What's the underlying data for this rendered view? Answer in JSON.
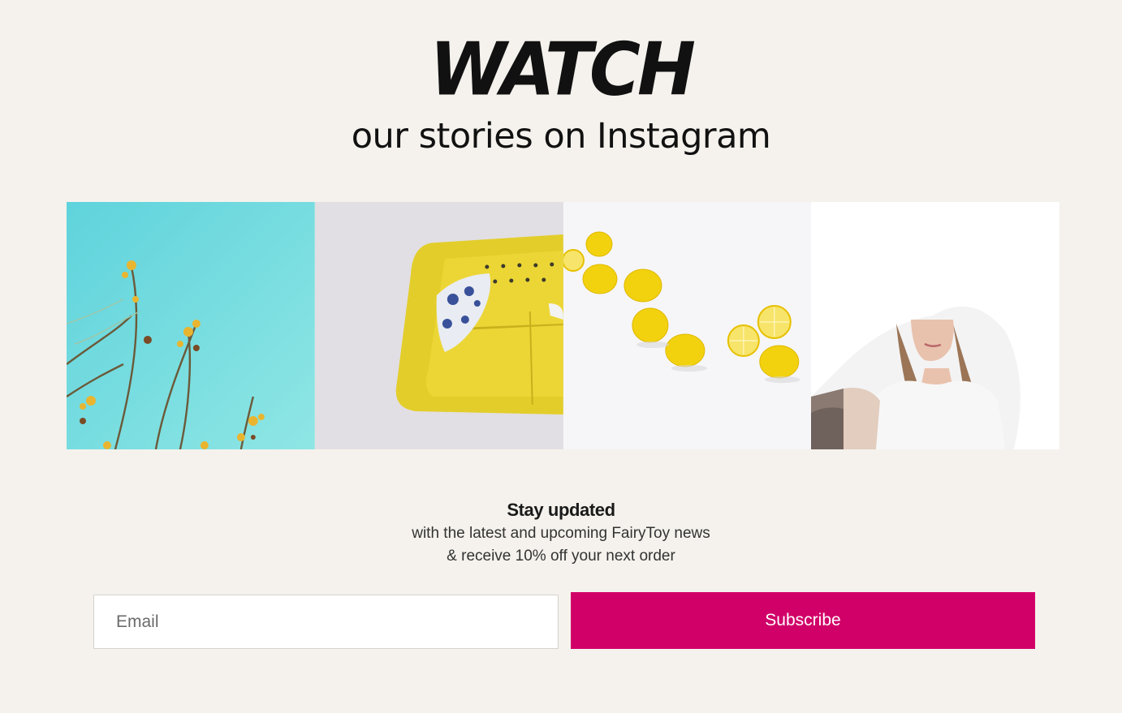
{
  "header": {
    "watch": "WATCH",
    "subtitle": "our stories on Instagram"
  },
  "instagram": {
    "tiles": [
      {
        "name": "flowers-sky-photo"
      },
      {
        "name": "yellow-sofa-photo"
      },
      {
        "name": "lemons-photo"
      },
      {
        "name": "woman-white-fabric-photo"
      }
    ]
  },
  "newsletter": {
    "title": "Stay updated",
    "line1": "with the latest and upcoming FairyToy news",
    "line2": "& receive 10% off your next order",
    "email_placeholder": "Email",
    "email_value": "",
    "subscribe_label": "Subscribe"
  },
  "colors": {
    "background": "#f5f2ed",
    "accent": "#d10068"
  }
}
